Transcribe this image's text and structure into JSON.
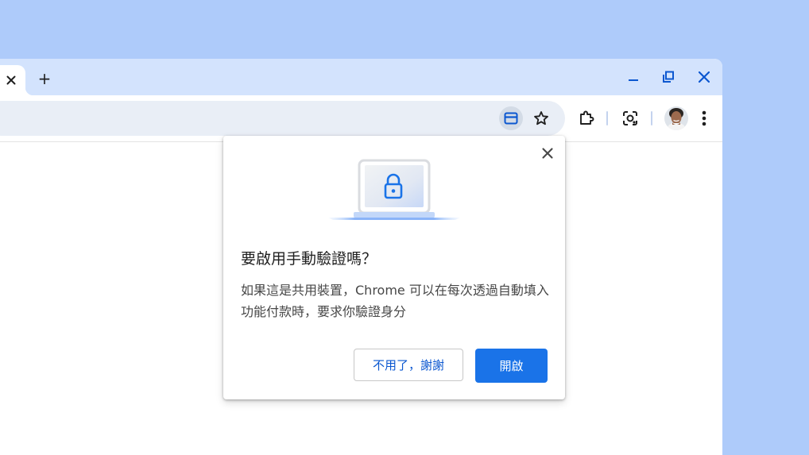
{
  "colors": {
    "background": "#aecbfa",
    "tabstrip": "#d3e3fd",
    "omnibox": "#e9eef6",
    "accent": "#0b57d0",
    "primary_button": "#1a73e8",
    "illustration_blue": "#8ab4f8"
  },
  "tabstrip": {
    "tab_close_icon": "close-icon",
    "new_tab_label": "+",
    "window_controls": [
      "minimize-icon",
      "restore-icon",
      "close-icon"
    ]
  },
  "toolbar": {
    "omnibox_icons": [
      "card-icon",
      "star-icon"
    ],
    "icons": [
      "extensions-icon",
      "lens-icon",
      "avatar",
      "more-vert-icon"
    ]
  },
  "dialog": {
    "title": "要啟用手動驗證嗎？",
    "body": "如果這是共用裝置，Chrome 可以在每次透過自動填入功能付款時，要求你驗證身分",
    "secondary_button": "不用了，謝謝",
    "primary_button": "開啟",
    "illustration": "laptop-lock-illustration"
  }
}
